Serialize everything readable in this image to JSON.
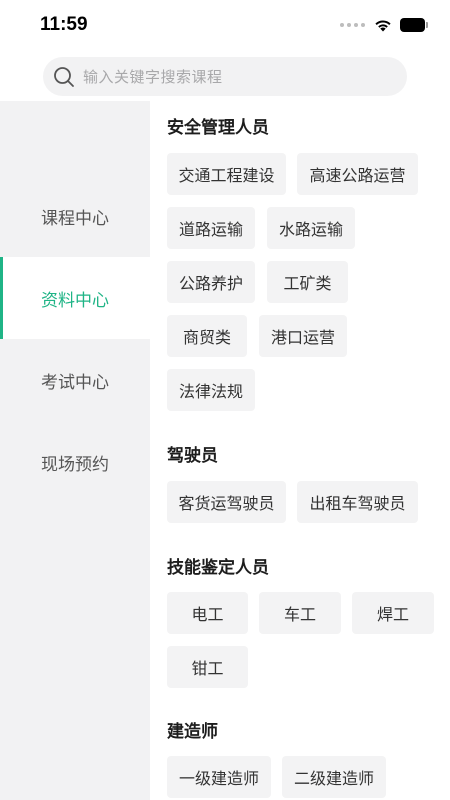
{
  "status_bar": {
    "time": "11:59"
  },
  "search": {
    "placeholder": "输入关键字搜索课程"
  },
  "sidebar": {
    "items": [
      {
        "label": "课程中心",
        "active": false
      },
      {
        "label": "资料中心",
        "active": true
      },
      {
        "label": "考试中心",
        "active": false
      },
      {
        "label": "现场预约",
        "active": false
      }
    ]
  },
  "sections": [
    {
      "title": "安全管理人员",
      "tags": [
        "交通工程建设",
        "高速公路运营",
        "道路运输",
        "水路运输",
        "公路养护",
        "工矿类",
        "商贸类",
        "港口运营",
        "法律法规"
      ]
    },
    {
      "title": "驾驶员",
      "tags": [
        "客货运驾驶员",
        "出租车驾驶员"
      ]
    },
    {
      "title": "技能鉴定人员",
      "tags": [
        "电工",
        "车工",
        "焊工",
        "钳工"
      ]
    },
    {
      "title": "建造师",
      "tags": [
        "一级建造师",
        "二级建造师"
      ]
    }
  ],
  "colors": {
    "accent": "#1fb486",
    "sidebar_bg": "#f2f2f3",
    "tag_bg": "#f3f3f4"
  },
  "icons": [
    "search-icon",
    "wifi-icon",
    "battery-icon",
    "signal-icon"
  ]
}
